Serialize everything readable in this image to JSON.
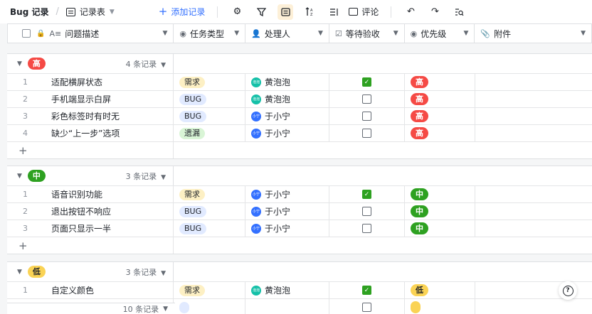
{
  "toolbar": {
    "title": "Bug 记录",
    "view_name": "记录表",
    "add_record": "添加记录",
    "comment": "评论"
  },
  "columns": {
    "desc": "问题描述",
    "type": "任务类型",
    "owner": "处理人",
    "check": "等待验收",
    "priority": "优先级",
    "attachment": "附件"
  },
  "colors": {
    "high": "#f54a45",
    "mid": "#2ea121",
    "low": "#fad355",
    "accent": "#3370ff",
    "tag_need": "#fdf0c4",
    "tag_bug": "#e1eaff",
    "tag_miss": "#d9f5d6"
  },
  "groups": [
    {
      "label": "高",
      "count": "4 条记录",
      "rows": [
        {
          "num": "1",
          "desc": "适配横屏状态",
          "type": "需求",
          "owner": "黄泡泡",
          "checked": true,
          "priority": "高"
        },
        {
          "num": "2",
          "desc": "手机端显示白屏",
          "type": "BUG",
          "owner": "黄泡泡",
          "checked": false,
          "priority": "高"
        },
        {
          "num": "3",
          "desc": "彩色标签时有时无",
          "type": "BUG",
          "owner": "于小宁",
          "checked": false,
          "priority": "高"
        },
        {
          "num": "4",
          "desc": "缺少“上一步”选项",
          "type": "遗漏",
          "owner": "于小宁",
          "checked": false,
          "priority": "高"
        }
      ]
    },
    {
      "label": "中",
      "count": "3 条记录",
      "rows": [
        {
          "num": "1",
          "desc": "语音识别功能",
          "type": "需求",
          "owner": "于小宁",
          "checked": true,
          "priority": "中"
        },
        {
          "num": "2",
          "desc": "退出按钮不响应",
          "type": "BUG",
          "owner": "于小宁",
          "checked": false,
          "priority": "中"
        },
        {
          "num": "3",
          "desc": "页面只显示一半",
          "type": "BUG",
          "owner": "于小宁",
          "checked": false,
          "priority": "中"
        }
      ]
    },
    {
      "label": "低",
      "count": "3 条记录",
      "rows": [
        {
          "num": "1",
          "desc": "自定义颜色",
          "type": "需求",
          "owner": "黄泡泡",
          "checked": true,
          "priority": "低"
        }
      ]
    }
  ],
  "footer": {
    "total": "10 条记录"
  },
  "help": "?"
}
